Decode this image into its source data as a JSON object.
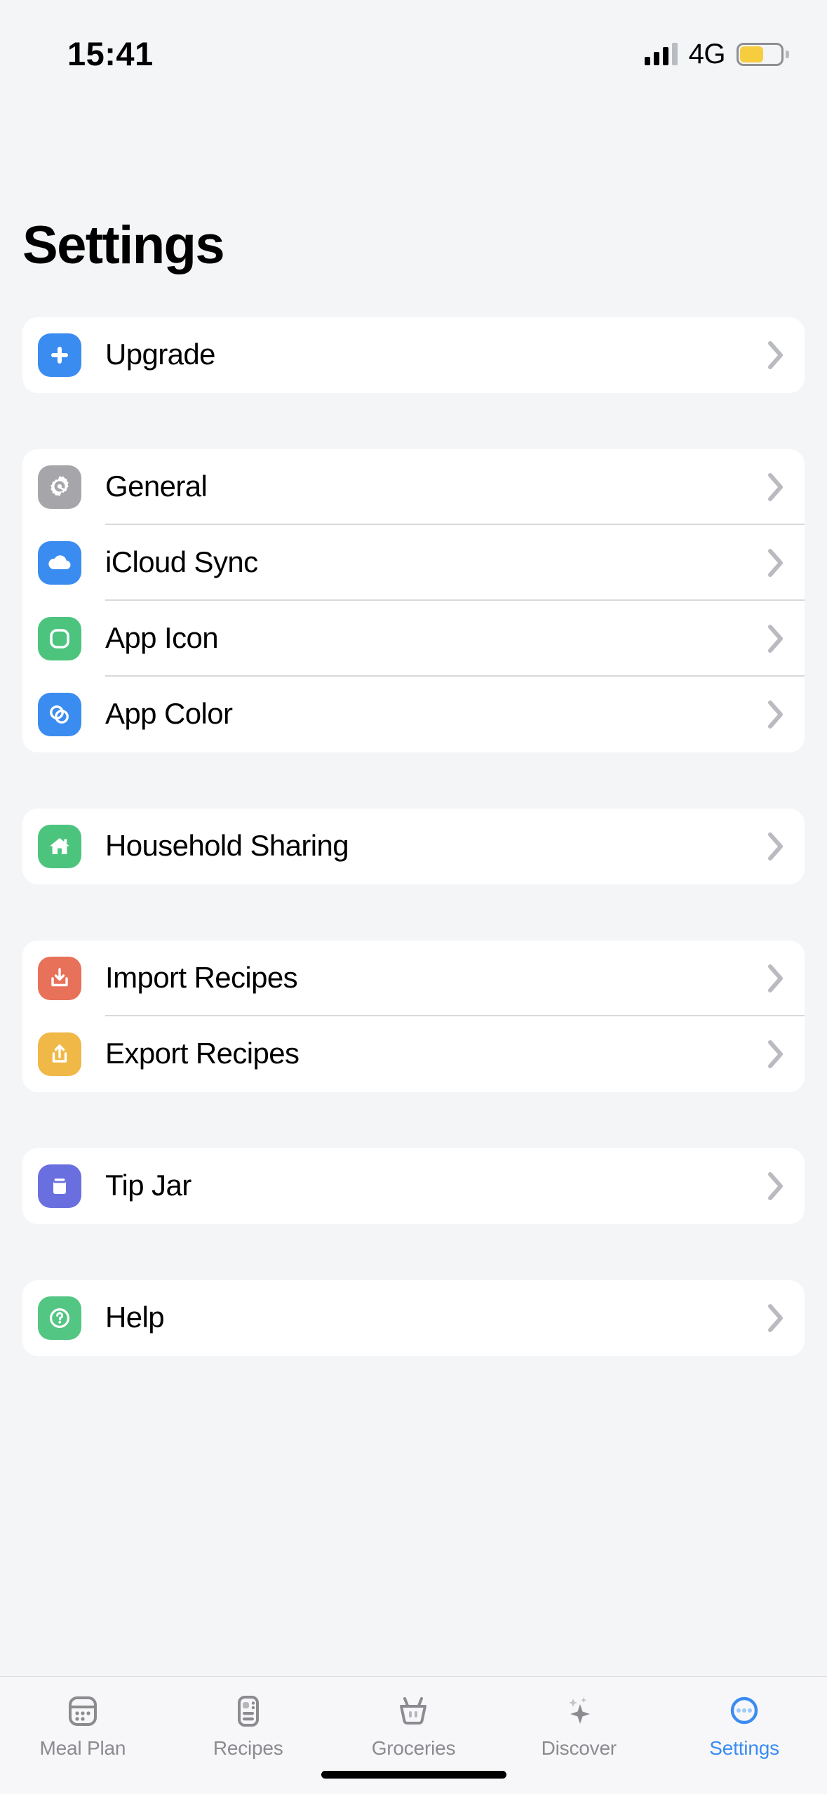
{
  "status_bar": {
    "time": "15:41",
    "network": "4G",
    "signal_icon": "cellular-signal-icon",
    "battery_icon": "battery-low-power-icon",
    "battery_color": "#f5cd3f"
  },
  "header": {
    "title": "Settings"
  },
  "theme": {
    "background": "#f4f5f7",
    "card": "#ffffff",
    "accent": "#3b8cf0",
    "separator": "#d8d9dd",
    "chevron": "#b9bbc0",
    "tab_inactive": "#8b8b90"
  },
  "sections": [
    {
      "name": "upgrade-section",
      "rows": [
        {
          "label": "Upgrade",
          "icon": "plus-icon",
          "icon_class": "ic-blue",
          "icon_color": "#3b8cf0"
        }
      ]
    },
    {
      "name": "app-settings-section",
      "rows": [
        {
          "label": "General",
          "icon": "gear-icon",
          "icon_class": "ic-gray",
          "icon_color": "#a6a6aa"
        },
        {
          "label": "iCloud Sync",
          "icon": "cloud-icon",
          "icon_class": "ic-cloud",
          "icon_color": "#3b8cf0"
        },
        {
          "label": "App Icon",
          "icon": "app-square-icon",
          "icon_class": "ic-green",
          "icon_color": "#4cc47e"
        },
        {
          "label": "App Color",
          "icon": "color-rings-icon",
          "icon_class": "ic-blue",
          "icon_color": "#3b8cf0"
        }
      ]
    },
    {
      "name": "sharing-section",
      "rows": [
        {
          "label": "Household Sharing",
          "icon": "house-icon",
          "icon_class": "ic-green2",
          "icon_color": "#4cc47e"
        }
      ]
    },
    {
      "name": "recipes-io-section",
      "rows": [
        {
          "label": "Import Recipes",
          "icon": "import-tray-icon",
          "icon_class": "ic-salmon",
          "icon_color": "#e8715a"
        },
        {
          "label": "Export Recipes",
          "icon": "export-share-icon",
          "icon_class": "ic-amber",
          "icon_color": "#f0b847"
        }
      ]
    },
    {
      "name": "tipjar-section",
      "rows": [
        {
          "label": "Tip Jar",
          "icon": "jar-icon",
          "icon_class": "ic-indigo",
          "icon_color": "#6a6fe0"
        }
      ]
    },
    {
      "name": "help-section",
      "rows": [
        {
          "label": "Help",
          "icon": "question-circle-icon",
          "icon_class": "ic-green3",
          "icon_color": "#53c683"
        }
      ]
    }
  ],
  "tab_bar": {
    "items": [
      {
        "label": "Meal Plan",
        "icon": "calendar-icon",
        "active": false
      },
      {
        "label": "Recipes",
        "icon": "recipe-card-icon",
        "active": false
      },
      {
        "label": "Groceries",
        "icon": "basket-icon",
        "active": false
      },
      {
        "label": "Discover",
        "icon": "sparkles-icon",
        "active": false
      },
      {
        "label": "Settings",
        "icon": "ellipsis-circle-icon",
        "active": true
      }
    ]
  }
}
